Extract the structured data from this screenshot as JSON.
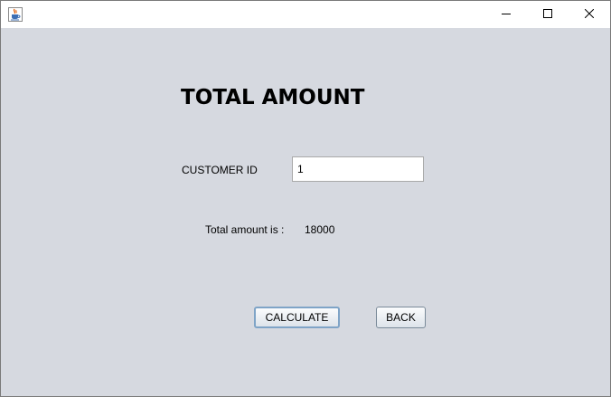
{
  "window": {
    "icon": "java-cup-icon",
    "controls": [
      "minimize-icon",
      "maximize-icon",
      "close-icon"
    ]
  },
  "form": {
    "heading": "TOTAL AMOUNT",
    "customer_id_label": "CUSTOMER ID",
    "customer_id_value": "1",
    "total_label": "Total amount  is :",
    "total_value": "18000",
    "calculate_label": "CALCULATE",
    "back_label": "BACK"
  }
}
